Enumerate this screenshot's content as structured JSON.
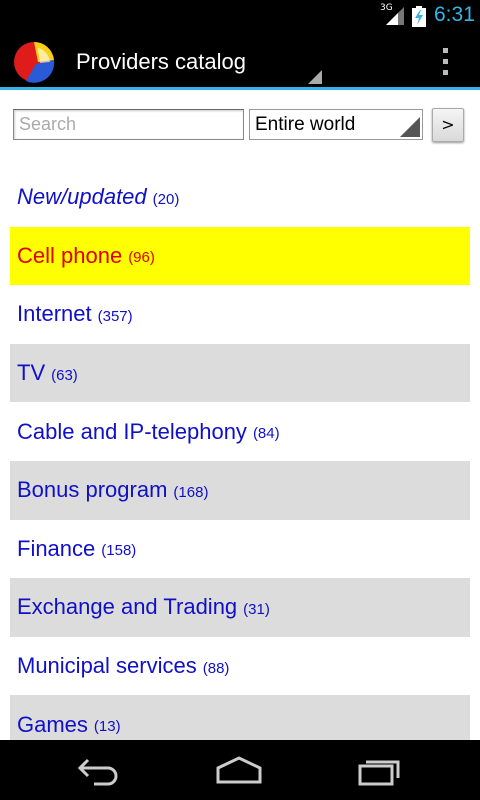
{
  "status_bar": {
    "network": "3G",
    "time": "6:31"
  },
  "action_bar": {
    "title": "Providers catalog"
  },
  "search": {
    "placeholder": "Search",
    "value": ""
  },
  "region": {
    "selected": "Entire world"
  },
  "go_button": {
    "label": ">"
  },
  "categories": [
    {
      "label": "New/updated",
      "count": "(20)"
    },
    {
      "label": "Cell phone",
      "count": "(96)"
    },
    {
      "label": "Internet",
      "count": "(357)"
    },
    {
      "label": "TV",
      "count": "(63)"
    },
    {
      "label": "Cable and IP-telephony",
      "count": "(84)"
    },
    {
      "label": "Bonus program",
      "count": "(168)"
    },
    {
      "label": "Finance",
      "count": "(158)"
    },
    {
      "label": "Exchange and Trading",
      "count": "(31)"
    },
    {
      "label": "Municipal services",
      "count": "(88)"
    },
    {
      "label": "Games",
      "count": "(13)"
    }
  ],
  "colors": {
    "accent": "#33b5e5",
    "link": "#1010c8",
    "selected_bg": "#ffff00",
    "selected_text": "#e00000",
    "alt_row": "#dcdcdc"
  }
}
